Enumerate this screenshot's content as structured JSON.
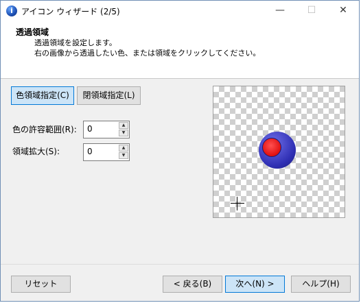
{
  "window": {
    "title": "アイコン ウィザード (2/5)",
    "icon_glyph": "i",
    "controls": {
      "minimize": "—",
      "maximize": "☐",
      "close": "✕"
    }
  },
  "header": {
    "title": "透過領域",
    "line1": "透過領域を設定します。",
    "line2": "右の画像から透過したい色、または領域をクリックしてください。"
  },
  "tabs": [
    {
      "label": "色領域指定(C)",
      "active": true
    },
    {
      "label": "閉領域指定(L)",
      "active": false
    }
  ],
  "fields": {
    "tolerance": {
      "label": "色の許容範囲(R):",
      "value": "0"
    },
    "expand": {
      "label": "領域拡大(S):",
      "value": "0"
    }
  },
  "spinner": {
    "up": "▲",
    "down": "▼"
  },
  "buttons": {
    "reset": "リセット",
    "back": "< 戻る(B)",
    "next": "次へ(N) >",
    "help": "ヘルプ(H)"
  }
}
